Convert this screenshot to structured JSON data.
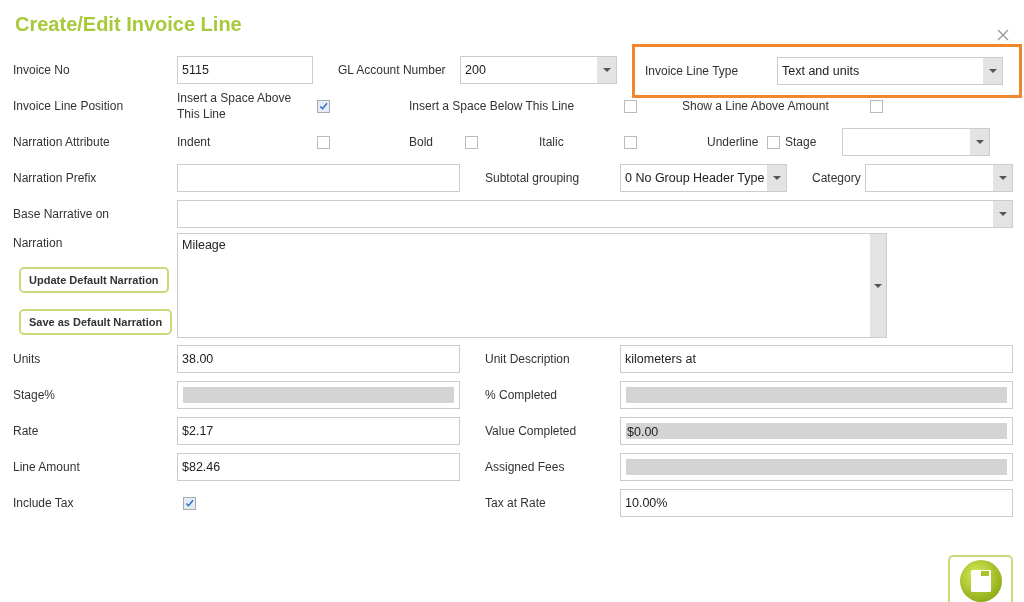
{
  "title": "Create/Edit Invoice Line",
  "header": {
    "invoice_no": {
      "label": "Invoice No",
      "value": "5115"
    },
    "gl_account": {
      "label": "GL Account Number",
      "value": "200"
    },
    "line_type": {
      "label": "Invoice Line Type",
      "value": "Text and units",
      "highlighted": true
    }
  },
  "position": {
    "label": "Invoice Line Position",
    "options": [
      {
        "label": "Insert a Space Above This Line",
        "checked": true
      },
      {
        "label": "Insert a Space Below This Line",
        "checked": false
      },
      {
        "label": "Show a Line Above Amount",
        "checked": false
      }
    ]
  },
  "attributes": {
    "label": "Narration Attribute",
    "options": [
      {
        "label": "Indent",
        "checked": false
      },
      {
        "label": "Bold",
        "checked": false
      },
      {
        "label": "Italic",
        "checked": false
      },
      {
        "label": "Underline",
        "checked": false
      }
    ],
    "stage": {
      "label": "Stage"
    }
  },
  "prefix": {
    "label": "Narration Prefix"
  },
  "subtotal": {
    "label": "Subtotal grouping",
    "value": "0 No Group Header Type"
  },
  "category": {
    "label": "Category"
  },
  "base_narrative": {
    "label": "Base Narrative on"
  },
  "narration": {
    "label": "Narration",
    "value": "Mileage",
    "buttons": [
      "Update Default Narration",
      "Save as Default Narration"
    ]
  },
  "details": [
    {
      "left": {
        "label": "Units",
        "kind": "text",
        "value": "38.00"
      },
      "right": {
        "label": "Unit Description",
        "kind": "text",
        "value": "kilometers at"
      }
    },
    {
      "left": {
        "label": "Stage%",
        "kind": "disabled"
      },
      "right": {
        "label": "% Completed",
        "kind": "disabled"
      }
    },
    {
      "left": {
        "label": "Rate",
        "kind": "text",
        "value": "$2.17"
      },
      "right": {
        "label": "Value Completed",
        "kind": "disabled",
        "value": "$0.00"
      }
    },
    {
      "left": {
        "label": "Line Amount",
        "kind": "text",
        "value": "$82.46"
      },
      "right": {
        "label": "Assigned Fees",
        "kind": "disabled"
      }
    },
    {
      "left": {
        "label": "Include Tax",
        "kind": "checkbox",
        "checked": true
      },
      "right": {
        "label": "Tax at Rate",
        "kind": "text",
        "value": "10.00%"
      }
    }
  ]
}
